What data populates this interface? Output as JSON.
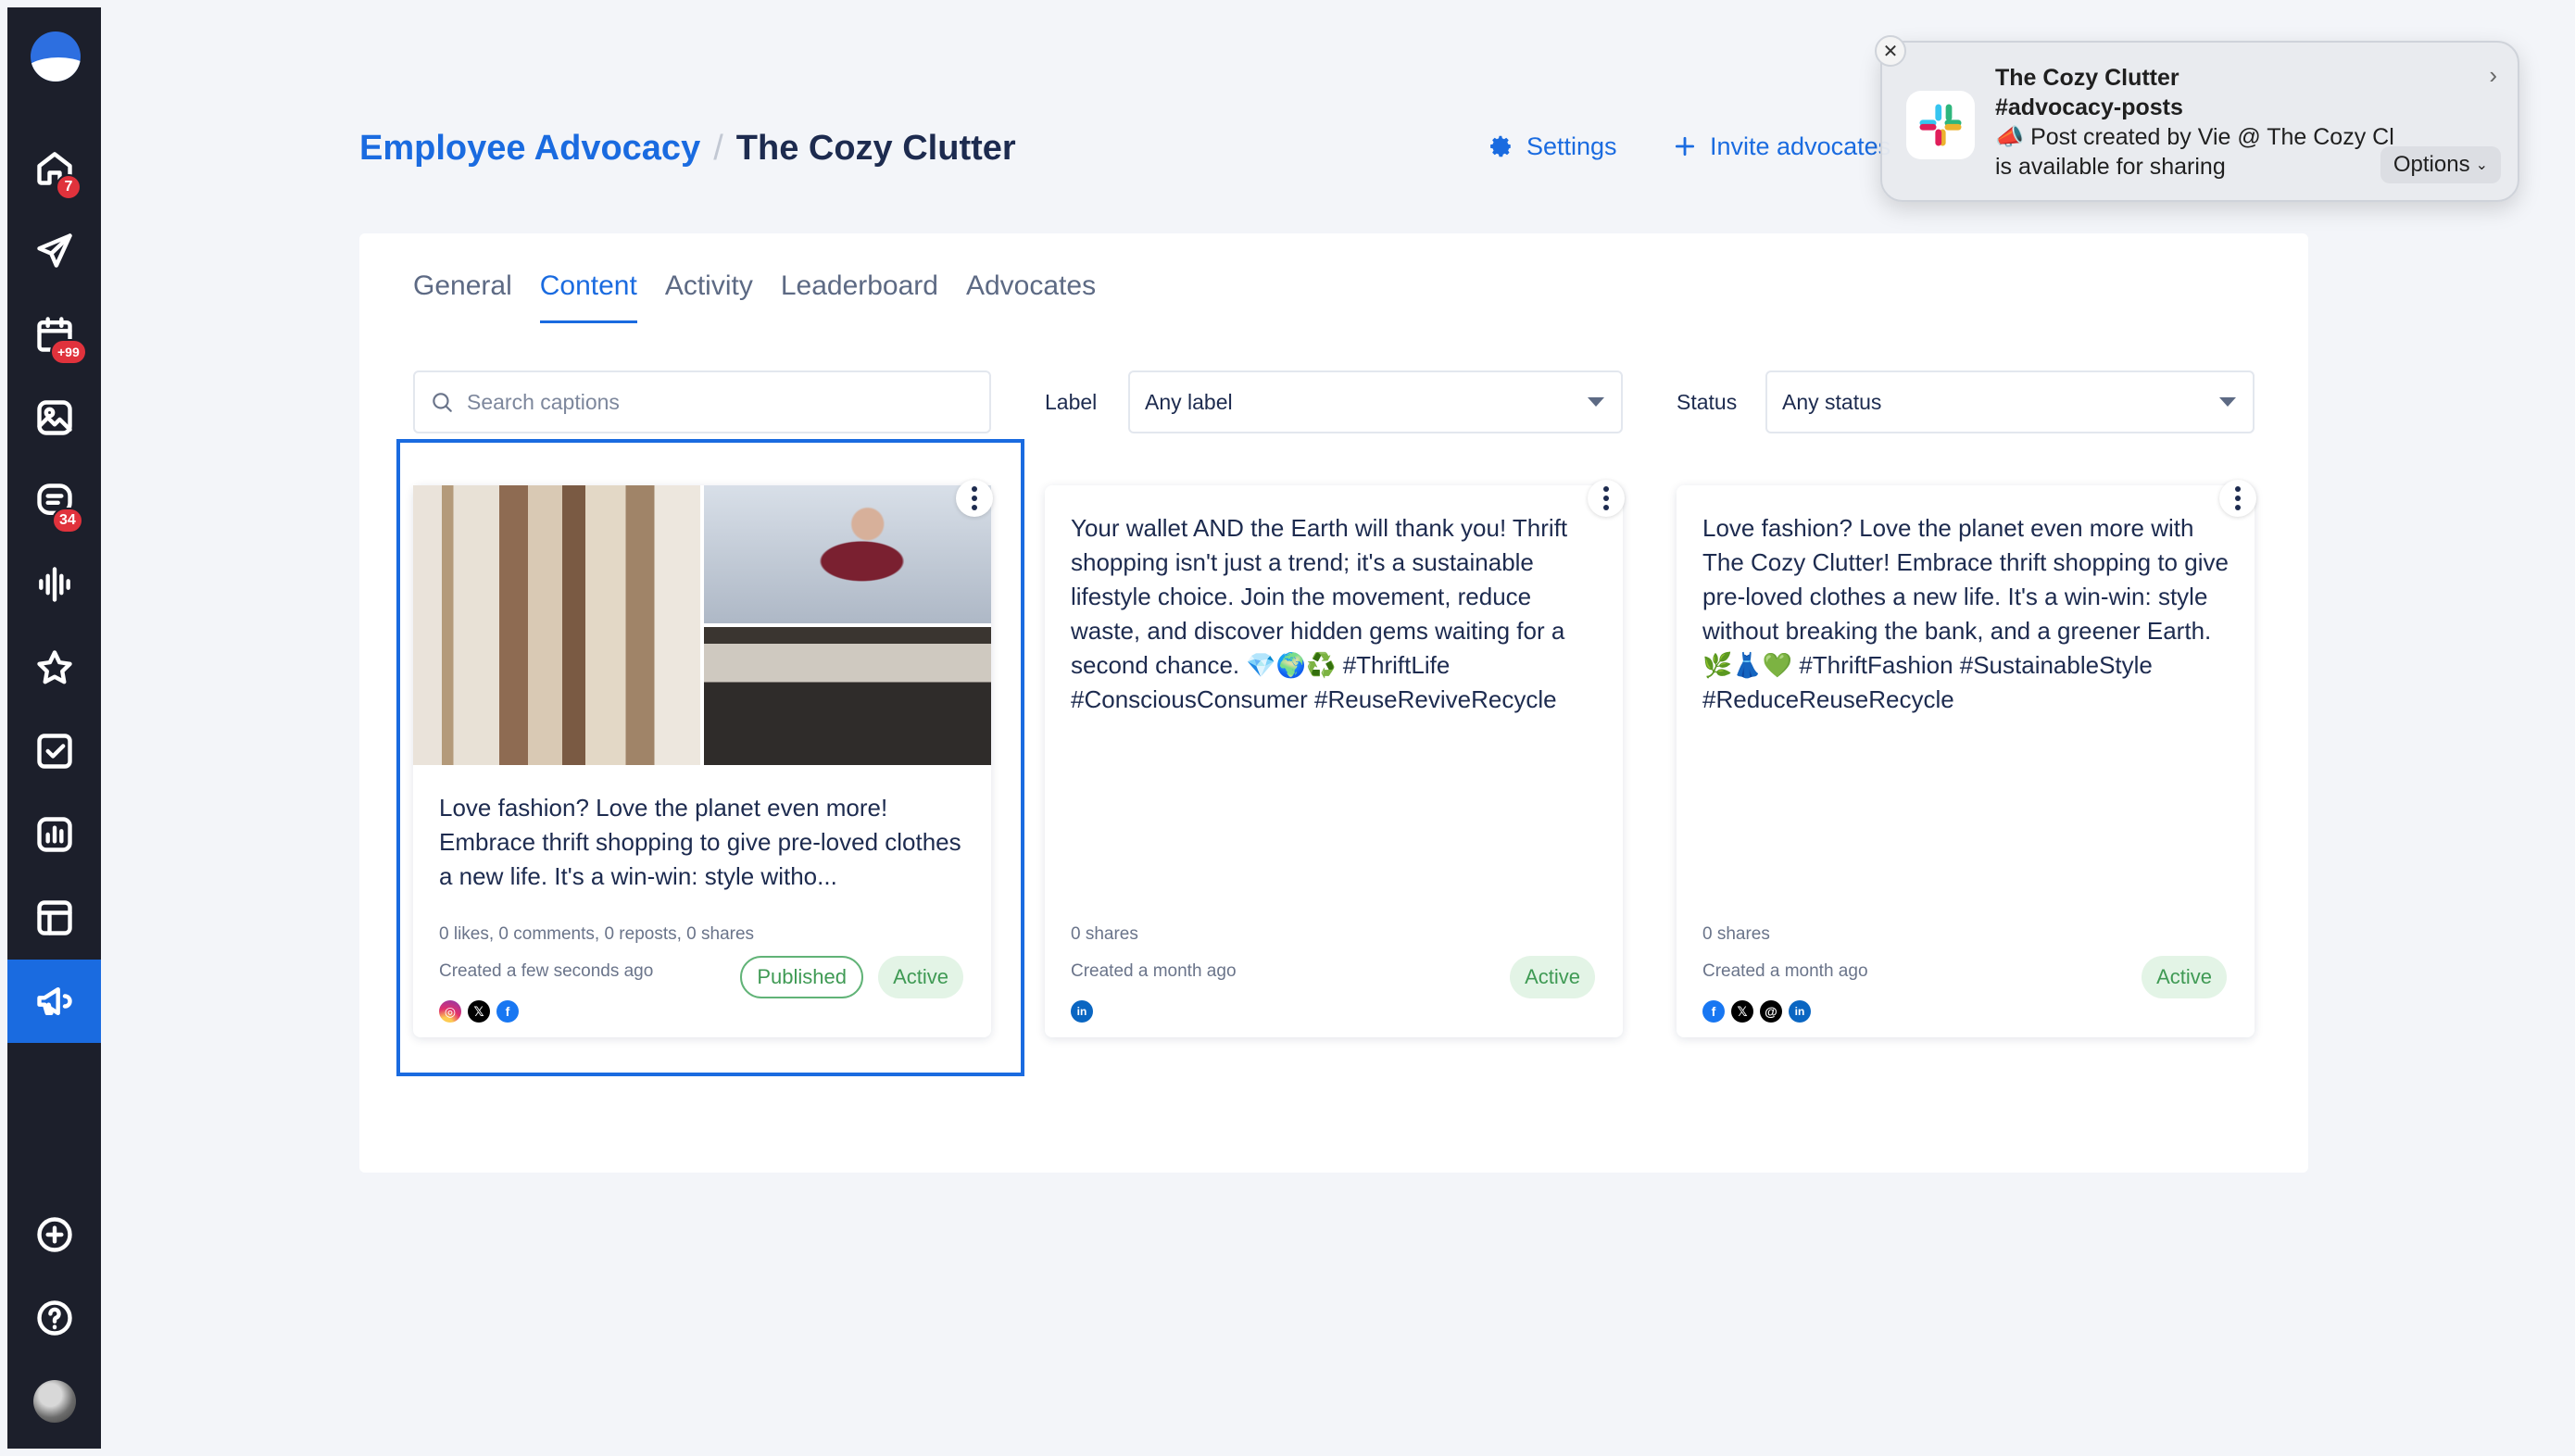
{
  "sidebar": {
    "items": [
      {
        "icon": "home-icon",
        "badge": "7"
      },
      {
        "icon": "send-icon",
        "badge": ""
      },
      {
        "icon": "calendar-icon",
        "badge": "+99"
      },
      {
        "icon": "media-library-icon",
        "badge": ""
      },
      {
        "icon": "inbox-icon",
        "badge": "34"
      },
      {
        "icon": "listening-icon",
        "badge": ""
      },
      {
        "icon": "star-icon",
        "badge": ""
      },
      {
        "icon": "tasks-icon",
        "badge": ""
      },
      {
        "icon": "analytics-icon",
        "badge": ""
      },
      {
        "icon": "layout-icon",
        "badge": ""
      },
      {
        "icon": "megaphone-icon",
        "badge": "",
        "active": true
      }
    ],
    "bottom": [
      "add-icon",
      "help-icon",
      "avatar"
    ]
  },
  "header": {
    "breadcrumb_link": "Employee Advocacy",
    "breadcrumb_sep": "/",
    "breadcrumb_current": "The Cozy Clutter",
    "settings_label": "Settings",
    "invite_label": "Invite advocates"
  },
  "tabs": [
    "General",
    "Content",
    "Activity",
    "Leaderboard",
    "Advocates"
  ],
  "active_tab": "Content",
  "filters": {
    "search_placeholder": "Search captions",
    "label_title": "Label",
    "label_value": "Any label",
    "status_title": "Status",
    "status_value": "Any status"
  },
  "posts": [
    {
      "caption": "Love fashion? Love the planet even more! Embrace thrift shopping to give pre-loved clothes a new life. It's a win-win: style witho...",
      "stats": "0 likes, 0 comments, 0 reposts, 0 shares",
      "created": "Created a few seconds ago",
      "badge_published": "Published",
      "badge_status": "Active",
      "networks": [
        "instagram",
        "x",
        "facebook"
      ]
    },
    {
      "caption": "Your wallet AND the Earth will thank you! Thrift shopping isn't just a trend; it's a sustainable lifestyle choice. Join the movement, reduce waste, and discover hidden gems waiting for a second chance. 💎🌍♻️ #ThriftLife #ConsciousConsumer #ReuseReviveRecycle",
      "stats": "0 shares",
      "created": "Created a month ago",
      "badge_status": "Active",
      "networks": [
        "linkedin"
      ]
    },
    {
      "caption": "Love fashion? Love the planet even more with The Cozy Clutter! Embrace thrift shopping to give pre-loved clothes a new life. It's a win-win: style without breaking the bank, and a greener Earth. 🌿👗💚 #ThriftFashion #SustainableStyle #ReduceReuseRecycle",
      "stats": "0 shares",
      "created": "Created a month ago",
      "badge_status": "Active",
      "networks": [
        "facebook",
        "x",
        "threads",
        "linkedin"
      ]
    }
  ],
  "notification": {
    "title_line1": "The Cozy Clutter",
    "title_line2": "#advocacy-posts",
    "body_line1": "📣 Post created by Vie @ The Cozy Clutter",
    "body_line2": "is available for sharing",
    "options_label": "Options"
  },
  "colors": {
    "accent": "#1a6be0",
    "sidebar": "#1c1f2b",
    "active_green": "#3f9a54",
    "badge_red": "#e0323c"
  }
}
